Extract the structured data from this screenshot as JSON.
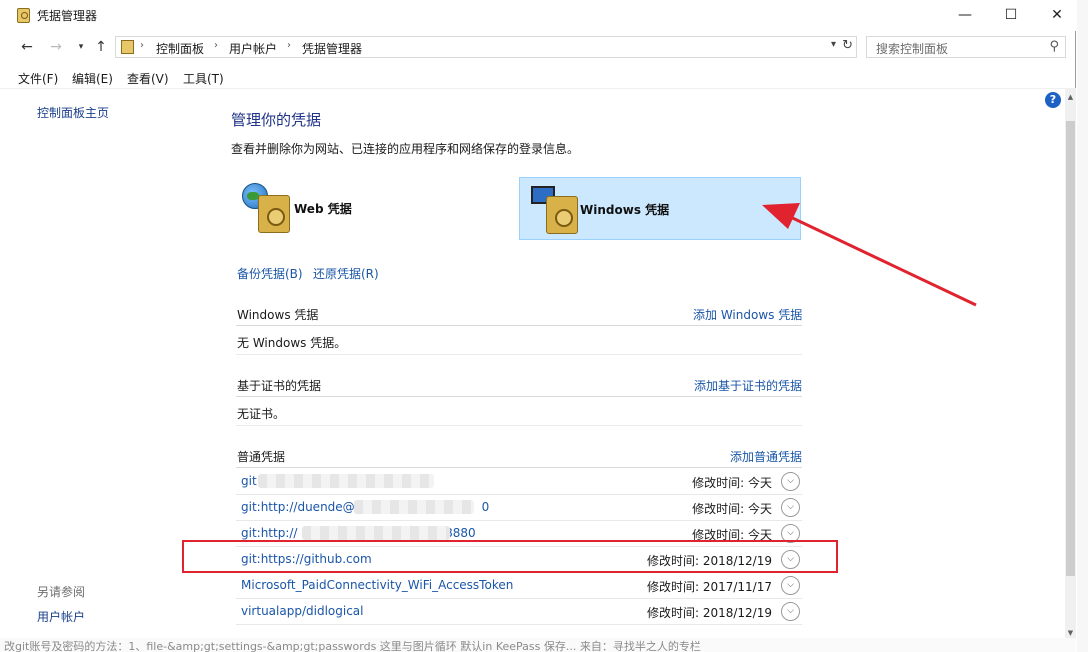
{
  "window": {
    "title": "凭据管理器",
    "minimize_glyph": "—",
    "maximize_glyph": "☐",
    "close_glyph": "✕"
  },
  "address_bar": {
    "crumbs": [
      "控制面板",
      "用户帐户",
      "凭据管理器"
    ],
    "separator": "›",
    "search_placeholder": "搜索控制面板"
  },
  "menu": [
    "文件(F)",
    "编辑(E)",
    "查看(V)",
    "工具(T)"
  ],
  "left_pane": {
    "home_link": "控制面板主页",
    "see_also_heading": "另请参阅",
    "see_also_link": "用户帐户"
  },
  "main": {
    "title": "管理你的凭据",
    "description": "查看并删除你为网站、已连接的应用程序和网络保存的登录信息。",
    "tiles": [
      {
        "label": "Web 凭据",
        "selected": false
      },
      {
        "label": "Windows 凭据",
        "selected": true
      }
    ],
    "backup_link": "备份凭据(B)",
    "restore_link": "还原凭据(R)",
    "sections": [
      {
        "title": "Windows 凭据",
        "add_link": "添加 Windows 凭据",
        "empty_text": "无 Windows 凭据。"
      },
      {
        "title": "基于证书的凭据",
        "add_link": "添加基于证书的凭据",
        "empty_text": "无证书。"
      },
      {
        "title": "普通凭据",
        "add_link": "添加普通凭据"
      }
    ],
    "generic_credentials": [
      {
        "name": "git",
        "modified_label": "修改时间:",
        "modified": "今天"
      },
      {
        "name": "git:http://duende@",
        "name_tail": "0",
        "modified_label": "修改时间:",
        "modified": "今天"
      },
      {
        "name": "git:http://",
        "name_tail": "18880",
        "modified_label": "修改时间:",
        "modified": "今天"
      },
      {
        "name": "git:https://github.com",
        "modified_label": "修改时间:",
        "modified": "2018/12/19"
      },
      {
        "name": "Microsoft_PaidConnectivity_WiFi_AccessToken",
        "modified_label": "修改时间:",
        "modified": "2017/11/17"
      },
      {
        "name": "virtualapp/didlogical",
        "modified_label": "修改时间:",
        "modified": "2018/12/19"
      }
    ]
  },
  "help_glyph": "?",
  "annotation_color": "#e0232e",
  "bottom_text": "改git账号及密码的方法：1、file-&amp;gt;settings-&amp;gt;passwords 这里与图片循环 默认in KeePass 保存...    来自：寻找半之人的专栏"
}
